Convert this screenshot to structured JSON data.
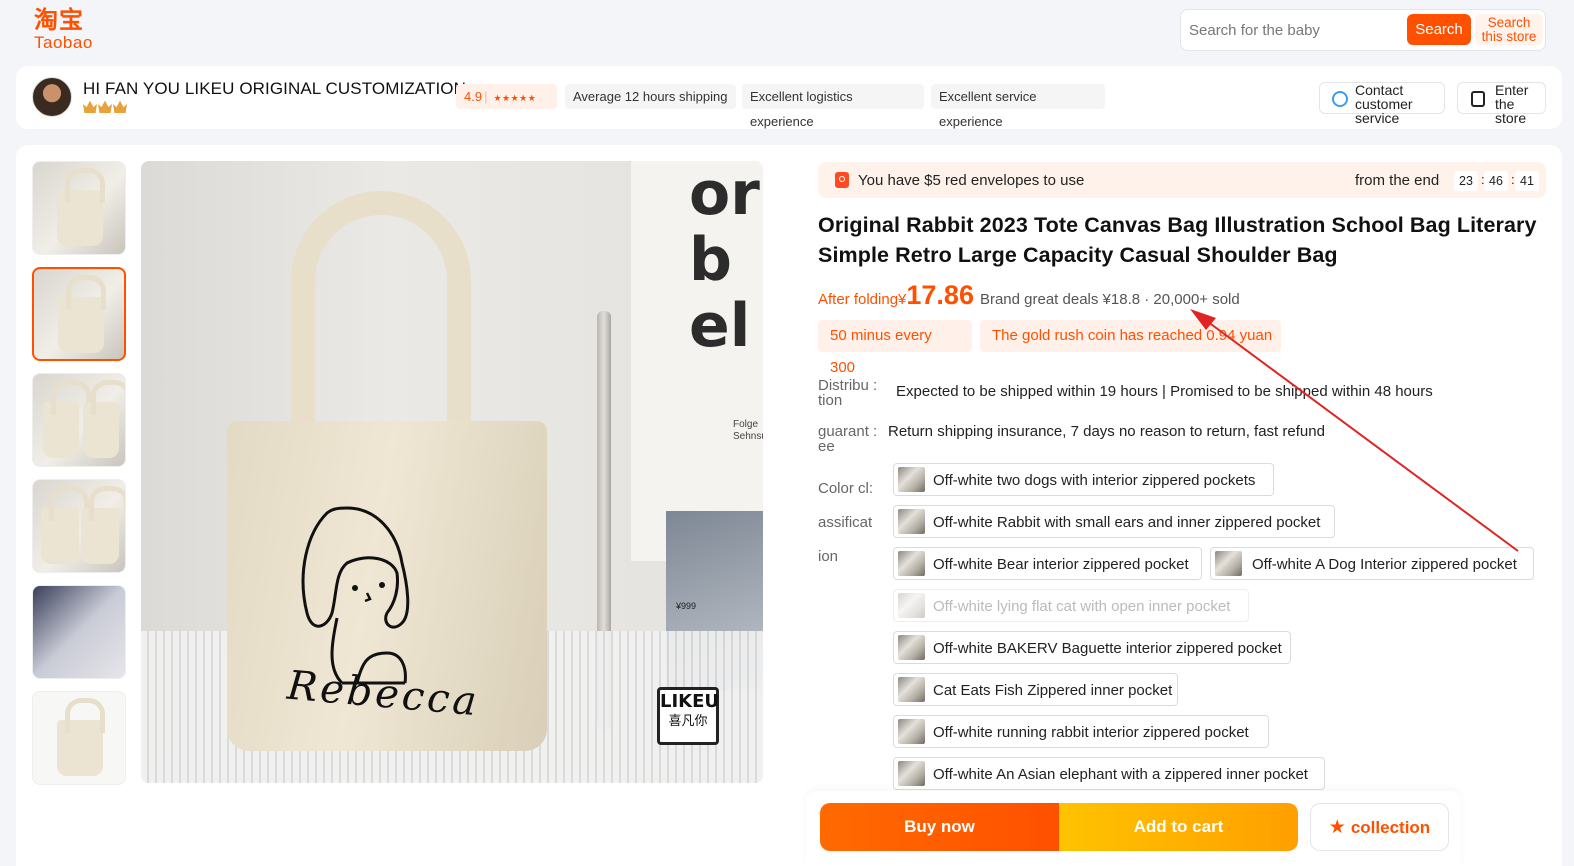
{
  "logo": {
    "cn": "淘宝",
    "en": "Taobao"
  },
  "search": {
    "placeholder": "Search for the baby",
    "button": "Search",
    "store_button": "Search this store"
  },
  "store": {
    "name": "HI FAN YOU LIKEU ORIGINAL CUSTOMIZATION",
    "rating": "4.9",
    "rating_stars": "★★★★★",
    "tags": [
      "Average 12 hours shipping",
      "Excellent logistics experience",
      "Excellent service experience"
    ],
    "contact_label": "Contact customer service",
    "enter_label": "Enter the store",
    "accent": "#ff5000"
  },
  "gallery": {
    "thumb_count": 6,
    "active_index": 1,
    "main_image_text": {
      "wall_text": "or bel",
      "small_text": "Folge Sehnsu",
      "price_sticker": "¥999",
      "tote_text": "Rebecca",
      "badge_l1": "LIKEU",
      "badge_l2": "喜凡你"
    }
  },
  "red_envelope": {
    "text": "You have $5 red envelopes to use",
    "from_end": "from the end",
    "countdown": [
      "23",
      "46",
      "41"
    ]
  },
  "product": {
    "title": "Original Rabbit 2023 Tote Canvas Bag Illustration School Bag Literary Simple Retro Large Capacity Casual Shoulder Bag",
    "after_folding": "After folding",
    "currency": "¥",
    "price": "17.86",
    "deals": "Brand great deals ¥18.8 · 20,000+ sold",
    "promos": [
      "50 minus every 300",
      "The gold rush coin has reached 0.94 yuan"
    ]
  },
  "distribution": {
    "label": "Distribu : tion",
    "value": "Expected to be shipped within 19 hours | Promised to be shipped within 48 hours"
  },
  "guarantee": {
    "label": "guarant : ee",
    "value": "Return shipping insurance, 7 days no reason to return, fast refund"
  },
  "color_classification": {
    "label": "Color  cl: assificat ion",
    "options": [
      {
        "label": "Off-white two dogs with interior zippered pockets",
        "available": true
      },
      {
        "label": "Off-white Rabbit with small ears and inner zippered pocket",
        "available": true
      },
      {
        "label": "Off-white Bear interior zippered pocket",
        "available": true
      },
      {
        "label": "Off-white A Dog Interior zippered pocket",
        "available": true
      },
      {
        "label": "Off-white lying flat cat with open inner pocket",
        "available": false
      },
      {
        "label": "Off-white BAKERV Baguette interior zippered pocket",
        "available": true
      },
      {
        "label": "Cat Eats Fish Zippered inner pocket",
        "available": true
      },
      {
        "label": "Off-white running rabbit interior zippered pocket",
        "available": true
      },
      {
        "label": "Off-white An Asian elephant with a zippered inner pocket",
        "available": true
      }
    ]
  },
  "actions": {
    "buy": "Buy now",
    "cart": "Add to cart",
    "collection": "collection"
  },
  "annotation": {
    "color": "#e02424"
  }
}
